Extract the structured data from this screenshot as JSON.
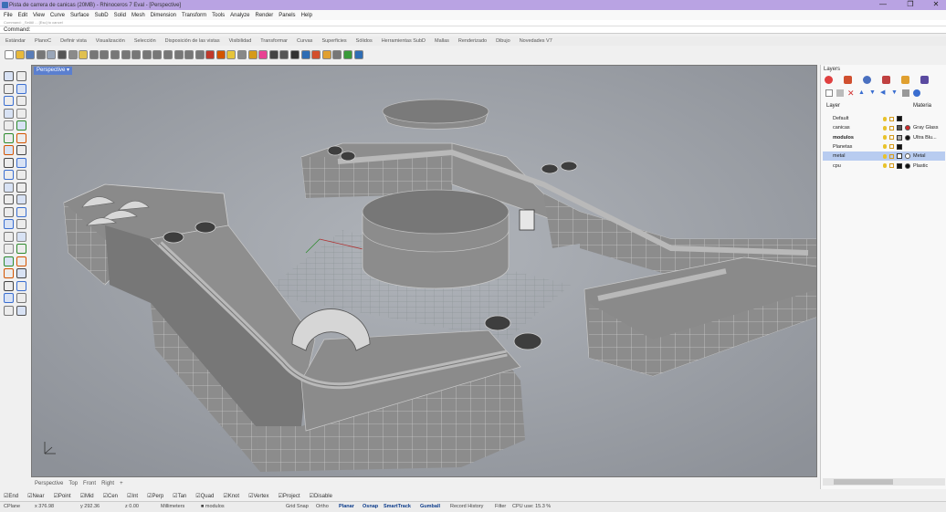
{
  "window": {
    "title": "Pista de carrera de canicas (20MB) - Rhinoceros 7 Eval - [Perspective]",
    "controls": [
      "—",
      "❐",
      "✕"
    ]
  },
  "menu": [
    "File",
    "Edit",
    "View",
    "Curve",
    "Surface",
    "SubD",
    "Solid",
    "Mesh",
    "Dimension",
    "Transform",
    "Tools",
    "Analyze",
    "Render",
    "Panels",
    "Help"
  ],
  "history_text": "Command: _SelAll   ...   [Esc] to cancel",
  "command": {
    "prompt": "Command:"
  },
  "toolbar_tabs": [
    "Estándar",
    "PlanoC",
    "Definir vista",
    "Visualización",
    "Selección",
    "Disposición de las vistas",
    "Visibilidad",
    "Transformar",
    "Curvas",
    "Superficies",
    "Sólidos",
    "Herramientas SubD",
    "Mallas",
    "Renderizado",
    "Dibujo",
    "Novedades V7"
  ],
  "toolbar_icons": [
    {
      "name": "new-file-icon",
      "color": "#ffffff"
    },
    {
      "name": "open-icon",
      "color": "#e8b93a"
    },
    {
      "name": "save-icon",
      "color": "#5a7db8"
    },
    {
      "name": "print-icon",
      "color": "#777777"
    },
    {
      "name": "import-icon",
      "color": "#9aa6b8"
    },
    {
      "name": "cut-icon",
      "color": "#555555"
    },
    {
      "name": "copy-icon",
      "color": "#8a8a8a"
    },
    {
      "name": "paste-icon",
      "color": "#e0c050"
    },
    {
      "name": "undo-icon",
      "color": "#777777"
    },
    {
      "name": "pan-icon",
      "color": "#777777"
    },
    {
      "name": "move-icon",
      "color": "#777777"
    },
    {
      "name": "rotate-view-icon",
      "color": "#777777"
    },
    {
      "name": "zoom-icon",
      "color": "#777777"
    },
    {
      "name": "zoom-window-icon",
      "color": "#777777"
    },
    {
      "name": "zoom-extents-icon",
      "color": "#777777"
    },
    {
      "name": "zoom-selected-icon",
      "color": "#777777"
    },
    {
      "name": "undo-view-icon",
      "color": "#777777"
    },
    {
      "name": "four-views-icon",
      "color": "#777777"
    },
    {
      "name": "grid-icon",
      "color": "#777777"
    },
    {
      "name": "select-icon",
      "color": "#c0392b"
    },
    {
      "name": "hide-icon",
      "color": "#d35400"
    },
    {
      "name": "light-icon",
      "color": "#e6c43a"
    },
    {
      "name": "properties-icon",
      "color": "#888888"
    },
    {
      "name": "lock-icon",
      "color": "#d59a1a"
    },
    {
      "name": "color-icon",
      "color": "#e84393"
    },
    {
      "name": "shaded-icon",
      "color": "#444444"
    },
    {
      "name": "rendered-icon",
      "color": "#555555"
    },
    {
      "name": "render-icon",
      "color": "#333333"
    },
    {
      "name": "material-icon",
      "color": "#2e6db4"
    },
    {
      "name": "snap-icon",
      "color": "#d34f2c"
    },
    {
      "name": "cplane-icon",
      "color": "#e0a030"
    },
    {
      "name": "gumball-icon",
      "color": "#777777"
    },
    {
      "name": "environment-icon",
      "color": "#3a9a3a"
    },
    {
      "name": "help-icon",
      "color": "#2e6db4"
    }
  ],
  "viewport": {
    "title": "Perspective",
    "tabs": [
      "Perspective",
      "Top",
      "Front",
      "Right"
    ]
  },
  "layers_panel": {
    "title": "Layers",
    "columns": [
      "Layer",
      "Materia"
    ],
    "rows": [
      {
        "name": "Default",
        "color": "#111111",
        "material": "",
        "mat_color": "",
        "selected": false,
        "bold": false
      },
      {
        "name": "canicas",
        "color": "#555555",
        "material": "Gray Glass",
        "mat_color": "#d12b2b",
        "selected": false,
        "bold": false
      },
      {
        "name": "modulos",
        "color": "#aaaaaa",
        "material": "Ultra Blu...",
        "mat_color": "#111111",
        "selected": false,
        "bold": true
      },
      {
        "name": "Planetas",
        "color": "#111111",
        "material": "",
        "mat_color": "",
        "selected": false,
        "bold": false
      },
      {
        "name": "metal",
        "color": "#ffffff",
        "material": "Metal",
        "mat_color": "#ffffff",
        "selected": true,
        "bold": false
      },
      {
        "name": "cpu",
        "color": "#111111",
        "material": "Plastic",
        "mat_color": "#111111",
        "selected": false,
        "bold": false
      }
    ]
  },
  "osnaps": [
    "End",
    "Near",
    "Point",
    "Mid",
    "Cen",
    "Int",
    "Perp",
    "Tan",
    "Quad",
    "Knot",
    "Vertex",
    "Project",
    "Disable"
  ],
  "status": {
    "cplane": "CPlane",
    "x": "x 376.98",
    "y": "y 292.36",
    "z": "z 0.00",
    "units": "Millimeters",
    "layer": "modulos",
    "grid_snap": "Grid Snap",
    "ortho": "Ortho",
    "planar": "Planar",
    "osnap": "Osnap",
    "smarttrack": "SmartTrack",
    "gumball": "Gumball",
    "record": "Record History",
    "filter": "Filter",
    "cpu": "CPU use: 15.3 %"
  }
}
